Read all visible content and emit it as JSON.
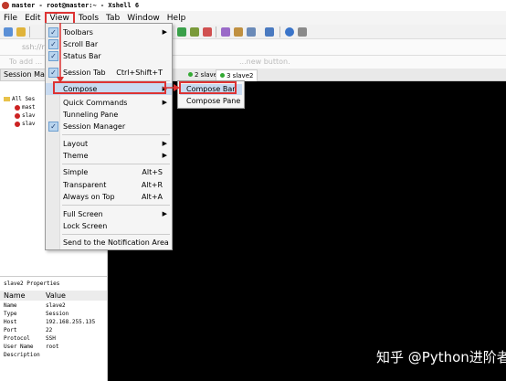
{
  "window": {
    "title": "master - root@master:~ - Xshell 6"
  },
  "menubar": [
    "File",
    "Edit",
    "View",
    "Tools",
    "Tab",
    "Window",
    "Help"
  ],
  "addressbar": {
    "placeholder": "ssh://r"
  },
  "linkbar": {
    "text": "To add ...",
    "hint": "...new button."
  },
  "session_manager": {
    "label": "Session Manag"
  },
  "tabs": [
    {
      "label": "2 slave1",
      "active": false
    },
    {
      "label": "3 slave2",
      "active": true
    }
  ],
  "tree": {
    "root": "All Ses",
    "items": [
      "mast",
      "slav",
      "slav"
    ]
  },
  "view_menu": {
    "items": [
      {
        "label": "Toolbars",
        "checked": true,
        "submenu": true
      },
      {
        "label": "Scroll Bar",
        "checked": true
      },
      {
        "label": "Status Bar",
        "checked": true
      },
      {
        "label": "Session Tab",
        "checked": true,
        "shortcut": "Ctrl+Shift+T"
      },
      {
        "label": "Compose",
        "submenu": true,
        "highlighted": true
      },
      {
        "label": "Quick Commands",
        "submenu": true
      },
      {
        "label": "Tunneling Pane"
      },
      {
        "label": "Session Manager",
        "checked": true
      },
      {
        "label": "Layout",
        "submenu": true
      },
      {
        "label": "Theme",
        "submenu": true
      },
      {
        "label": "Simple",
        "shortcut": "Alt+S"
      },
      {
        "label": "Transparent",
        "shortcut": "Alt+R"
      },
      {
        "label": "Always on Top",
        "shortcut": "Alt+A"
      },
      {
        "label": "Full Screen",
        "submenu": true
      },
      {
        "label": "Lock Screen"
      },
      {
        "label": "Send to the Notification Area"
      }
    ]
  },
  "compose_submenu": {
    "items": [
      {
        "label": "Compose Bar",
        "highlighted": true
      },
      {
        "label": "Compose Pane"
      }
    ]
  },
  "properties": {
    "title": "slave2 Properties",
    "columns": [
      "Name",
      "Value"
    ],
    "rows": [
      [
        "Name",
        "slave2"
      ],
      [
        "Type",
        "Session"
      ],
      [
        "Host",
        "192.168.255.135"
      ],
      [
        "Port",
        "22"
      ],
      [
        "Protocol",
        "SSH"
      ],
      [
        "User Name",
        "root"
      ],
      [
        "Description",
        ""
      ]
    ]
  },
  "watermark": "知乎 @Python进阶者",
  "colors": {
    "highlight_box": "#dd3333",
    "terminal_bg": "#000000",
    "menu_highlight": "#c8daf0"
  }
}
